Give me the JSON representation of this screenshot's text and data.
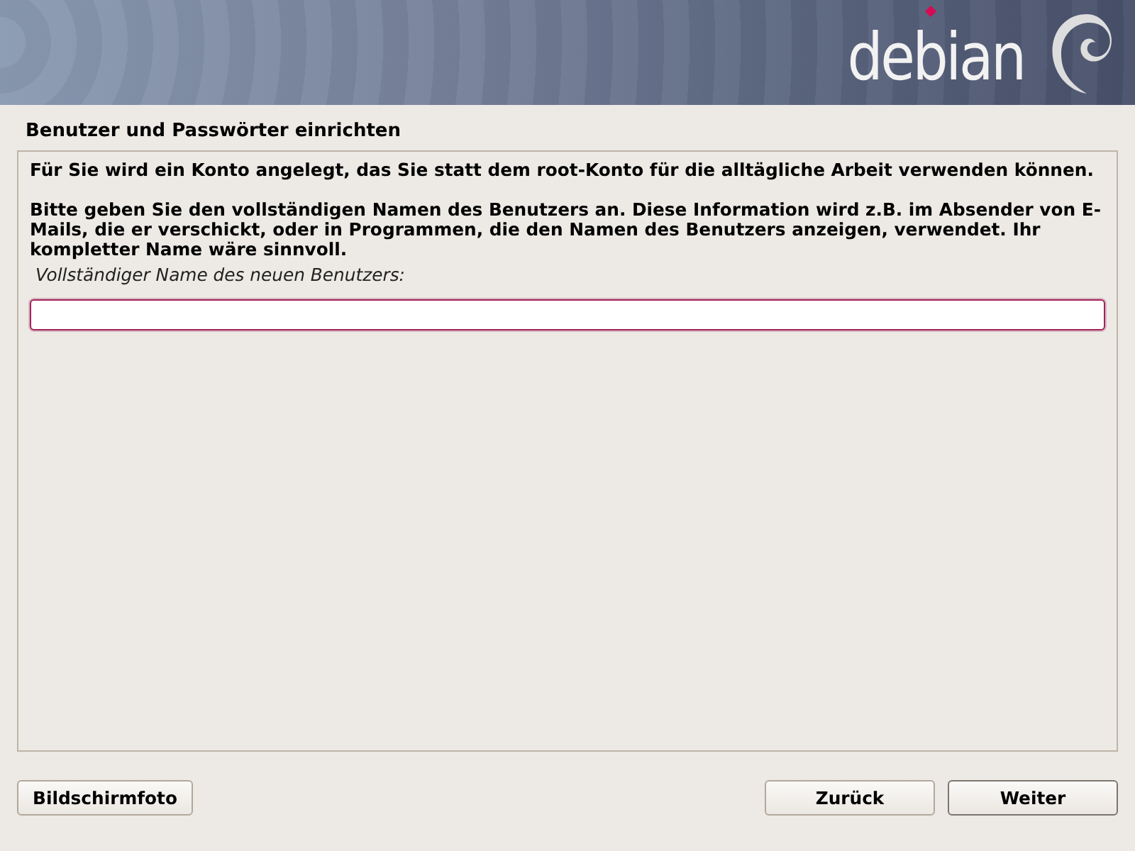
{
  "banner": {
    "logo": "debian"
  },
  "title": "Benutzer und Passwörter einrichten",
  "paragraphs": [
    "Für Sie wird ein Konto angelegt, das Sie statt dem root-Konto für die alltägliche Arbeit verwenden können.",
    "Bitte geben Sie den vollständigen Namen des Benutzers an. Diese Information wird z.B. im Absender von E-Mails, die er verschickt, oder in Programmen, die den Namen des Benutzers anzeigen, verwendet. Ihr kompletter Name wäre sinnvoll."
  ],
  "field": {
    "label": "Vollständiger Name des neuen Benutzers:",
    "focused": true
  },
  "left_buttons": [
    {
      "label": "Bildschirmfoto",
      "default": false
    }
  ],
  "right_buttons": [
    {
      "label": "Zurück",
      "default": false
    },
    {
      "label": "Weiter",
      "default": true
    }
  ]
}
